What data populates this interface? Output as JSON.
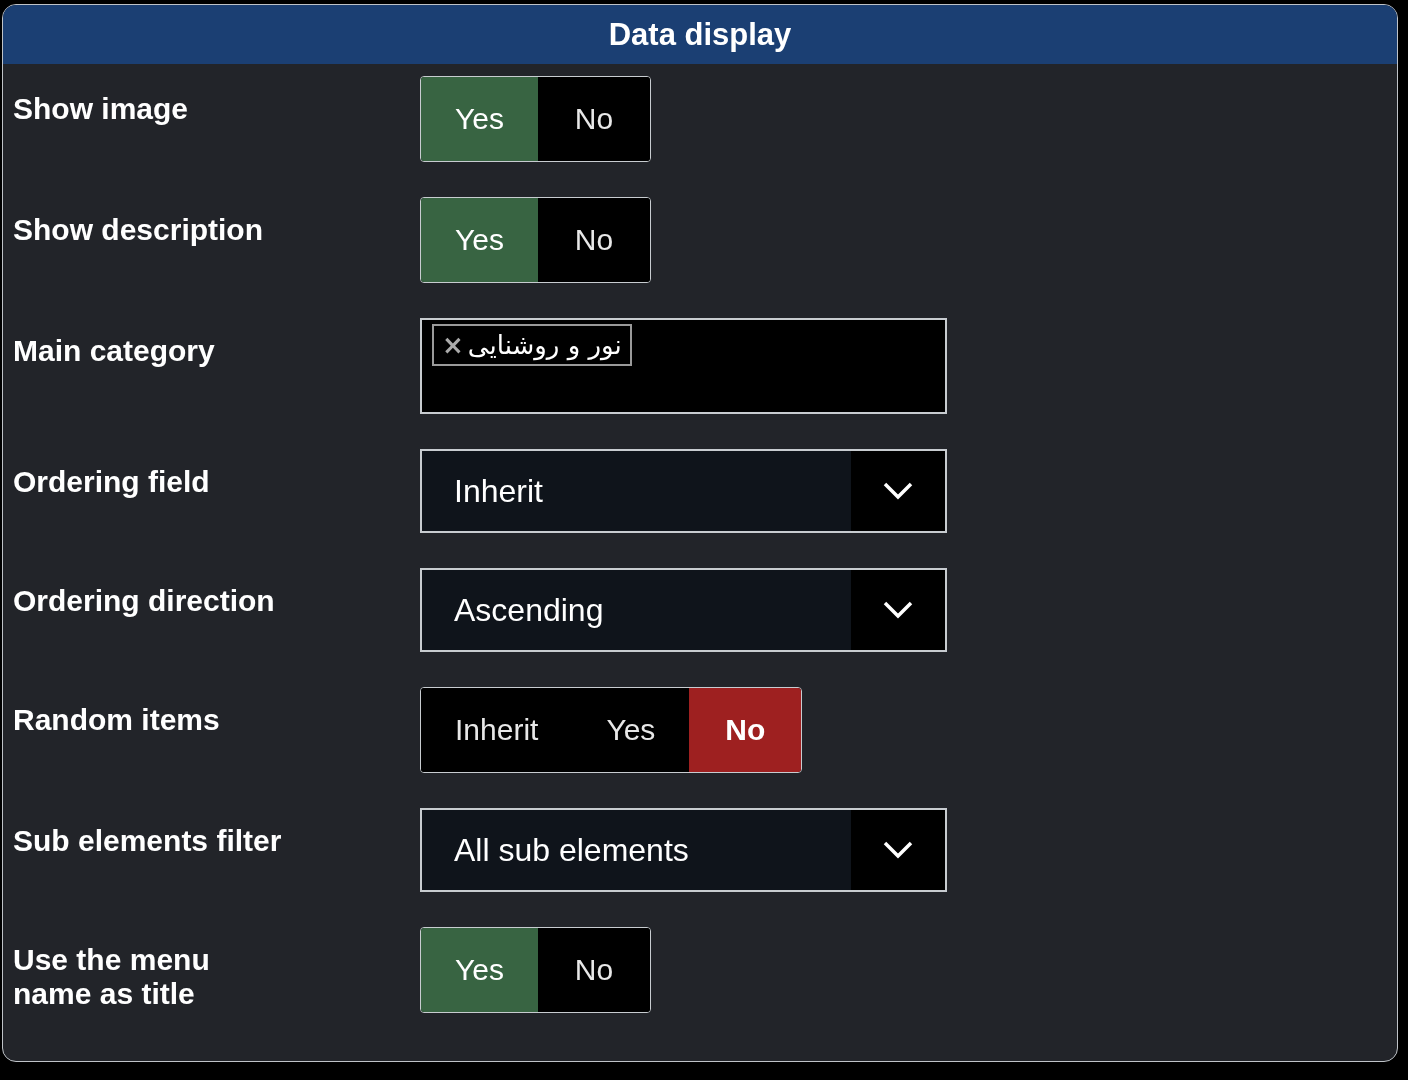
{
  "panel": {
    "title": "Data display"
  },
  "fields": [
    {
      "kind": "toggle",
      "label": "Show image",
      "options": [
        {
          "label": "Yes",
          "selected": true,
          "color": "#386442",
          "bold": false
        },
        {
          "label": "No",
          "selected": false,
          "color": "#000000",
          "bold": false
        }
      ]
    },
    {
      "kind": "toggle",
      "label": "Show description",
      "options": [
        {
          "label": "Yes",
          "selected": true,
          "color": "#386442",
          "bold": false
        },
        {
          "label": "No",
          "selected": false,
          "color": "#000000",
          "bold": false
        }
      ]
    },
    {
      "kind": "tags",
      "label": "Main category",
      "tags": [
        {
          "label": "نور و روشنایی",
          "remove": "×"
        }
      ]
    },
    {
      "kind": "select",
      "label": "Ordering field",
      "value": "Inherit"
    },
    {
      "kind": "select",
      "label": "Ordering direction",
      "value": "Ascending"
    },
    {
      "kind": "toggle",
      "label": "Random items",
      "options": [
        {
          "label": "Inherit",
          "selected": false,
          "color": "#000000",
          "bold": false
        },
        {
          "label": "Yes",
          "selected": false,
          "color": "#000000",
          "bold": false
        },
        {
          "label": "No",
          "selected": true,
          "color": "#9e2020",
          "bold": true
        }
      ]
    },
    {
      "kind": "select",
      "label": "Sub elements filter",
      "value": "All sub elements"
    },
    {
      "kind": "toggle",
      "label": "Use the menu\nname as title",
      "options": [
        {
          "label": "Yes",
          "selected": true,
          "color": "#386442",
          "bold": false
        },
        {
          "label": "No",
          "selected": false,
          "color": "#000000",
          "bold": false
        }
      ]
    }
  ]
}
